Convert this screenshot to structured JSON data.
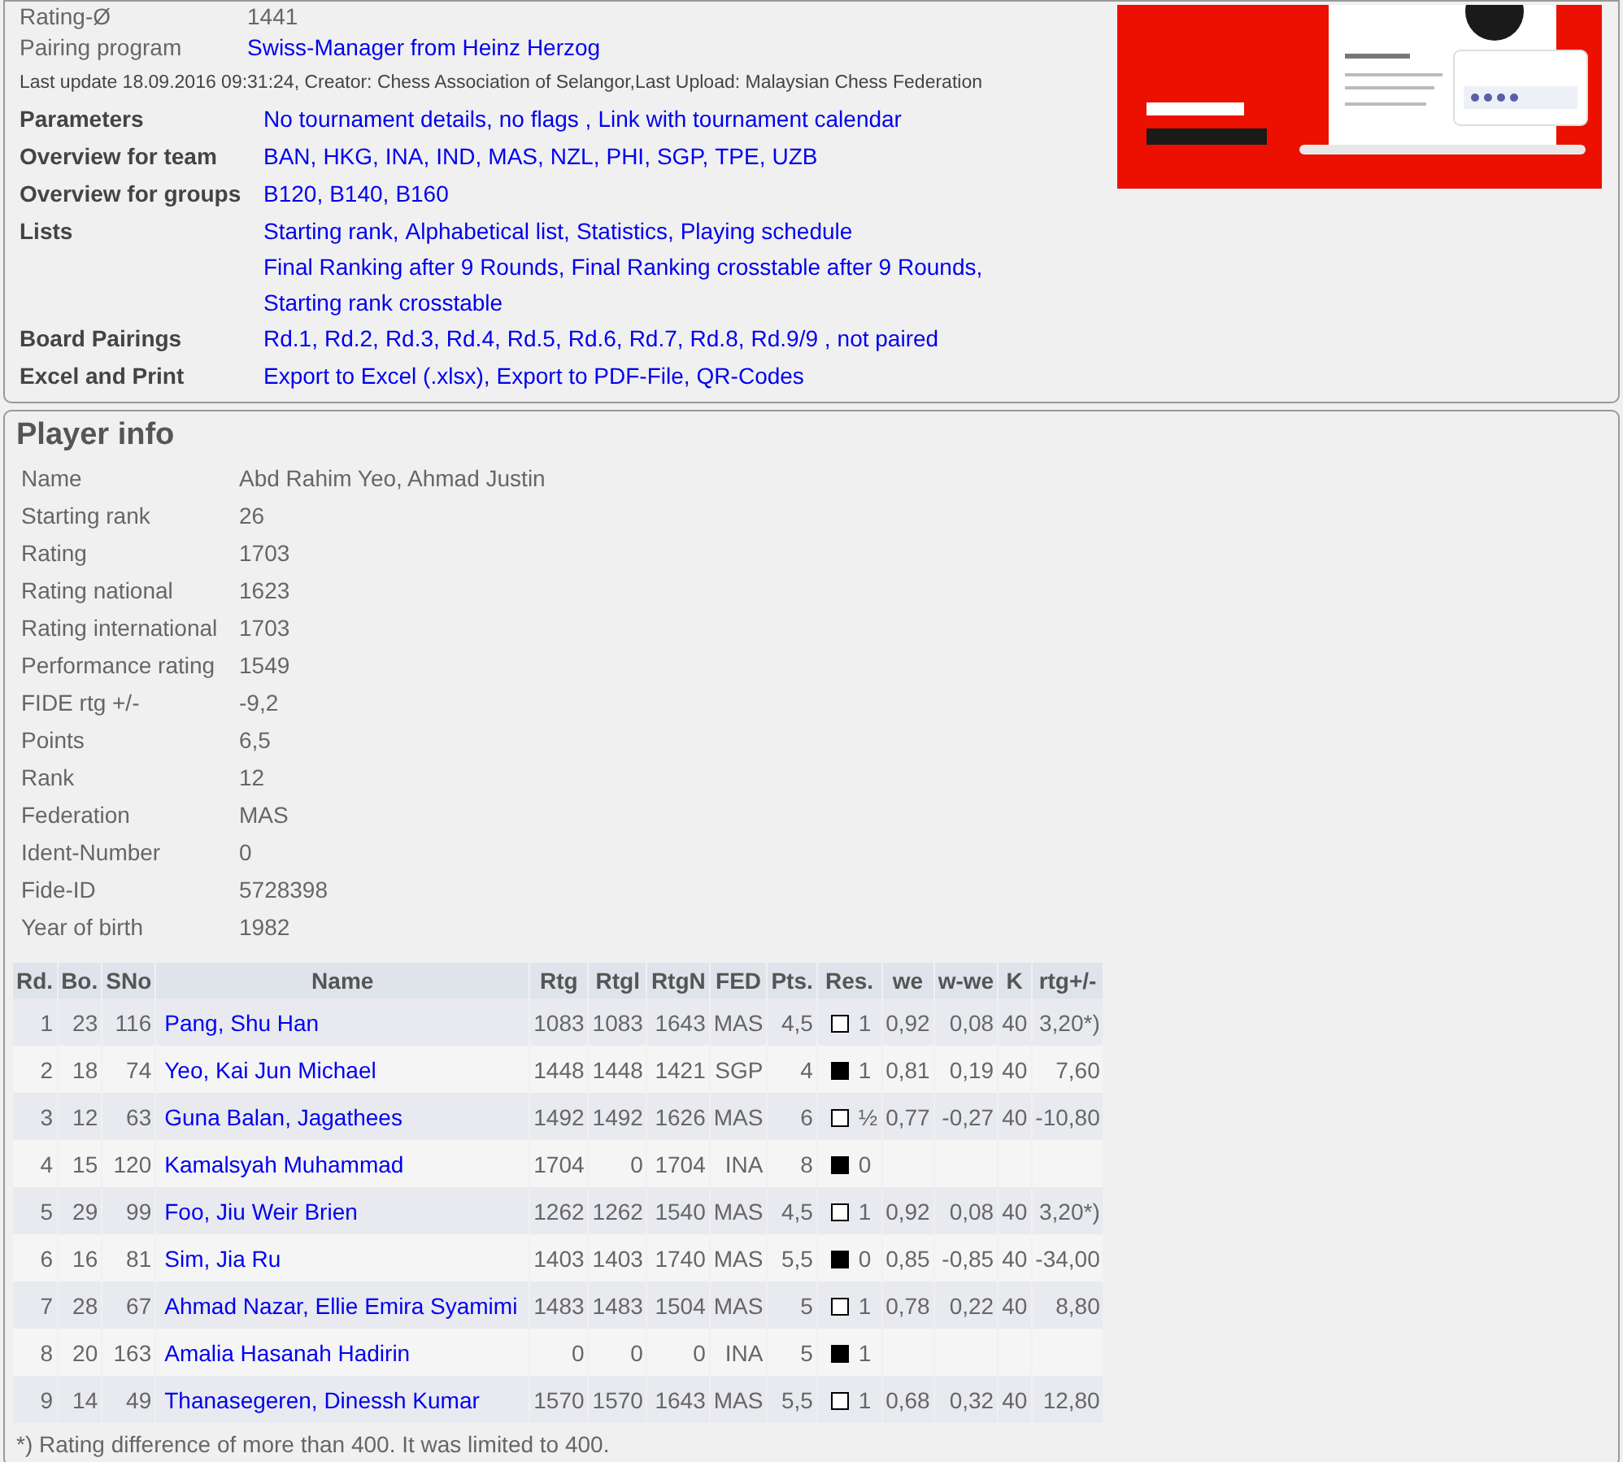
{
  "tournament_info": {
    "plain_rows": [
      {
        "label": "Rating-Ø",
        "value": "1441",
        "kind": "text"
      },
      {
        "label": "Pairing program",
        "value": "Swiss-Manager from Heinz Herzog",
        "kind": "link"
      }
    ],
    "last_update": "Last update 18.09.2016 09:31:24, Creator: Chess Association of Selangor,Last Upload: Malaysian Chess Federation",
    "link_rows": [
      {
        "label": "Parameters",
        "lines": [
          [
            "No tournament details,",
            "no flags ,",
            "Link with tournament calendar"
          ]
        ]
      },
      {
        "label": "Overview for team",
        "lines": [
          [
            "BAN,",
            "HKG,",
            "INA,",
            "IND,",
            "MAS,",
            "NZL,",
            "PHI,",
            "SGP,",
            "TPE,",
            "UZB"
          ]
        ]
      },
      {
        "label": "Overview for groups",
        "lines": [
          [
            "B120,",
            "B140,",
            "B160"
          ]
        ]
      },
      {
        "label": "Lists",
        "lines": [
          [
            "Starting rank,",
            "Alphabetical list,",
            "Statistics,",
            "Playing schedule"
          ],
          [
            "Final Ranking after 9 Rounds,",
            "Final Ranking crosstable after 9 Rounds,",
            "Starting rank crosstable"
          ]
        ]
      },
      {
        "label": "Board Pairings",
        "lines": [
          [
            "Rd.1,",
            "Rd.2,",
            "Rd.3,",
            "Rd.4,",
            "Rd.5,",
            "Rd.6,",
            "Rd.7,",
            "Rd.8,",
            "Rd.9/9 ,",
            "not paired"
          ]
        ]
      },
      {
        "label": "Excel and Print",
        "lines": [
          [
            "Export to Excel (.xlsx),",
            "Export to PDF-File,",
            "QR-Codes"
          ]
        ]
      }
    ]
  },
  "player_info": {
    "title": "Player info",
    "fields": [
      {
        "label": "Name",
        "value": "Abd Rahim Yeo, Ahmad Justin"
      },
      {
        "label": "Starting rank",
        "value": "26"
      },
      {
        "label": "Rating",
        "value": "1703"
      },
      {
        "label": "Rating national",
        "value": "1623"
      },
      {
        "label": "Rating international",
        "value": "1703"
      },
      {
        "label": "Performance rating",
        "value": "1549"
      },
      {
        "label": "FIDE rtg +/-",
        "value": "-9,2"
      },
      {
        "label": "Points",
        "value": "6,5"
      },
      {
        "label": "Rank",
        "value": "12"
      },
      {
        "label": "Federation",
        "value": "MAS"
      },
      {
        "label": "Ident-Number",
        "value": "0"
      },
      {
        "label": "Fide-ID",
        "value": "5728398"
      },
      {
        "label": "Year of birth",
        "value": "1982"
      }
    ],
    "table": {
      "columns": [
        "Rd.",
        "Bo.",
        "SNo",
        "Name",
        "Rtg",
        "Rtgl",
        "RtgN",
        "FED",
        "Pts.",
        "Res.",
        "we",
        "w-we",
        "K",
        "rtg+/-"
      ],
      "rows": [
        {
          "rd": "1",
          "bo": "23",
          "sno": "116",
          "name": "Pang, Shu Han",
          "rtg": "1083",
          "rtgi": "1083",
          "rtgn": "1643",
          "fed": "MAS",
          "pts": "4,5",
          "black_piece": false,
          "res": "1",
          "we": "0,92",
          "wwe": "0,08",
          "k": "40",
          "diff": "3,20*)"
        },
        {
          "rd": "2",
          "bo": "18",
          "sno": "74",
          "name": "Yeo, Kai Jun Michael",
          "rtg": "1448",
          "rtgi": "1448",
          "rtgn": "1421",
          "fed": "SGP",
          "pts": "4",
          "black_piece": true,
          "res": "1",
          "we": "0,81",
          "wwe": "0,19",
          "k": "40",
          "diff": "7,60"
        },
        {
          "rd": "3",
          "bo": "12",
          "sno": "63",
          "name": "Guna Balan, Jagathees",
          "rtg": "1492",
          "rtgi": "1492",
          "rtgn": "1626",
          "fed": "MAS",
          "pts": "6",
          "black_piece": false,
          "res": "½",
          "we": "0,77",
          "wwe": "-0,27",
          "k": "40",
          "diff": "-10,80"
        },
        {
          "rd": "4",
          "bo": "15",
          "sno": "120",
          "name": "Kamalsyah Muhammad",
          "rtg": "1704",
          "rtgi": "0",
          "rtgn": "1704",
          "fed": "INA",
          "pts": "8",
          "black_piece": true,
          "res": "0"
        },
        {
          "rd": "5",
          "bo": "29",
          "sno": "99",
          "name": "Foo, Jiu Weir Brien",
          "rtg": "1262",
          "rtgi": "1262",
          "rtgn": "1540",
          "fed": "MAS",
          "pts": "4,5",
          "black_piece": false,
          "res": "1",
          "we": "0,92",
          "wwe": "0,08",
          "k": "40",
          "diff": "3,20*)"
        },
        {
          "rd": "6",
          "bo": "16",
          "sno": "81",
          "name": "Sim, Jia Ru",
          "rtg": "1403",
          "rtgi": "1403",
          "rtgn": "1740",
          "fed": "MAS",
          "pts": "5,5",
          "black_piece": true,
          "res": "0",
          "we": "0,85",
          "wwe": "-0,85",
          "k": "40",
          "diff": "-34,00"
        },
        {
          "rd": "7",
          "bo": "28",
          "sno": "67",
          "name": "Ahmad Nazar, Ellie Emira Syamimi",
          "rtg": "1483",
          "rtgi": "1483",
          "rtgn": "1504",
          "fed": "MAS",
          "pts": "5",
          "black_piece": false,
          "res": "1",
          "we": "0,78",
          "wwe": "0,22",
          "k": "40",
          "diff": "8,80"
        },
        {
          "rd": "8",
          "bo": "20",
          "sno": "163",
          "name": "Amalia Hasanah Hadirin",
          "rtg": "0",
          "rtgi": "0",
          "rtgn": "0",
          "fed": "INA",
          "pts": "5",
          "black_piece": true,
          "res": "1"
        },
        {
          "rd": "9",
          "bo": "14",
          "sno": "49",
          "name": "Thanasegeren, Dinessh Kumar",
          "rtg": "1570",
          "rtgi": "1570",
          "rtgn": "1643",
          "fed": "MAS",
          "pts": "5,5",
          "black_piece": false,
          "res": "1",
          "we": "0,68",
          "wwe": "0,32",
          "k": "40",
          "diff": "12,80"
        }
      ]
    },
    "footnote": "*) Rating difference of more than 400. It was limited to 400."
  }
}
